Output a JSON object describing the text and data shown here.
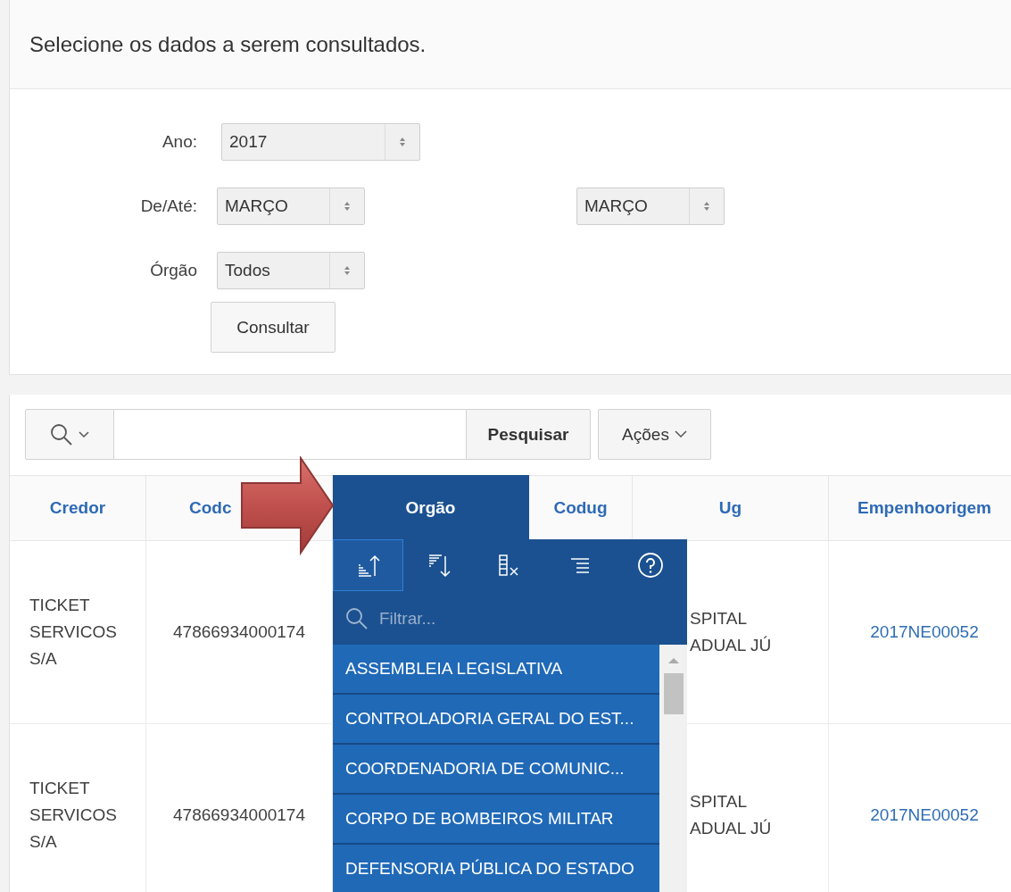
{
  "header": {
    "title": "Selecione os dados a serem consultados."
  },
  "form": {
    "fields": [
      {
        "label": "Ano:",
        "values": [
          "2017"
        ]
      },
      {
        "label": "De/Até:",
        "values": [
          "MARÇO",
          "MARÇO"
        ]
      },
      {
        "label": "Órgão",
        "values": [
          "Todos"
        ]
      }
    ],
    "submit": "Consultar"
  },
  "toolbar": {
    "search_button": "Pesquisar",
    "actions_button": "Ações"
  },
  "table": {
    "columns": [
      {
        "label": "Credor",
        "selected": false
      },
      {
        "label": "Codc",
        "selected": false
      },
      {
        "label": "Orgão",
        "selected": true
      },
      {
        "label": "Codug",
        "selected": false
      },
      {
        "label": "Ug",
        "selected": false
      },
      {
        "label": "Empenhoorigem",
        "selected": false
      }
    ],
    "rows": [
      {
        "credor": "TICKET SERVICOS S/A",
        "codcredor": "47866934000174",
        "ug": "SPITAL ADUAL JÚ",
        "empenhoorigem": "2017NE00052"
      },
      {
        "credor": "TICKET SERVICOS S/A",
        "codcredor": "47866934000174",
        "ug": "SPITAL ADUAL JÚ",
        "empenhoorigem": "2017NE00052"
      }
    ]
  },
  "column_menu": {
    "actions": [
      {
        "kind": "sort-ascending",
        "selected": true
      },
      {
        "kind": "sort-descending",
        "selected": false
      },
      {
        "kind": "hide-column",
        "selected": false
      },
      {
        "kind": "control-break",
        "selected": false
      },
      {
        "kind": "help",
        "selected": false
      }
    ],
    "filter": {
      "placeholder": "Filtrar..."
    },
    "items": [
      "ASSEMBLEIA LEGISLATIVA",
      "CONTROLADORIA GERAL DO EST...",
      "COORDENADORIA DE COMUNIC...",
      "CORPO DE BOMBEIROS MILITAR",
      "DEFENSORIA PÚBLICA DO ESTADO"
    ]
  }
}
